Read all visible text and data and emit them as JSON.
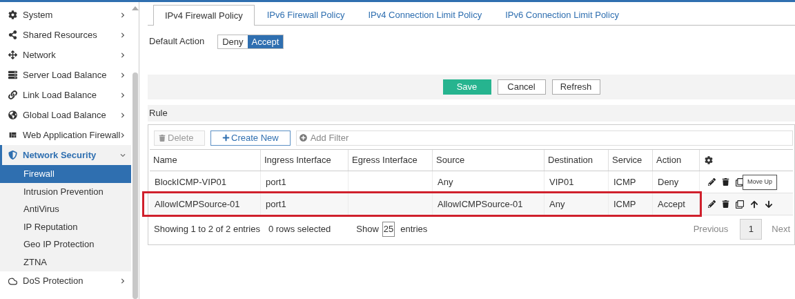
{
  "sidebar": {
    "items": [
      {
        "label": "System",
        "expanded": false
      },
      {
        "label": "Shared Resources",
        "expanded": false
      },
      {
        "label": "Network",
        "expanded": false
      },
      {
        "label": "Server Load Balance",
        "expanded": false
      },
      {
        "label": "Link Load Balance",
        "expanded": false
      },
      {
        "label": "Global Load Balance",
        "expanded": false
      },
      {
        "label": "Web Application Firewall",
        "expanded": false
      },
      {
        "label": "Network Security",
        "expanded": true,
        "children": [
          {
            "label": "Firewall",
            "selected": true
          },
          {
            "label": "Intrusion Prevention",
            "selected": false
          },
          {
            "label": "AntiVirus",
            "selected": false
          },
          {
            "label": "IP Reputation",
            "selected": false
          },
          {
            "label": "Geo IP Protection",
            "selected": false
          },
          {
            "label": "ZTNA",
            "selected": false
          }
        ]
      },
      {
        "label": "DoS Protection",
        "expanded": false
      }
    ]
  },
  "tabs": [
    {
      "label": "IPv4 Firewall Policy",
      "selected": true
    },
    {
      "label": "IPv6 Firewall Policy",
      "selected": false
    },
    {
      "label": "IPv4 Connection Limit Policy",
      "selected": false
    },
    {
      "label": "IPv6 Connection Limit Policy",
      "selected": false
    }
  ],
  "default_action": {
    "label": "Default Action",
    "options": [
      {
        "label": "Deny",
        "selected": false
      },
      {
        "label": "Accept",
        "selected": true
      }
    ]
  },
  "buttons": {
    "save": "Save",
    "cancel": "Cancel",
    "refresh": "Refresh"
  },
  "rule": {
    "title": "Rule",
    "toolbar": {
      "delete": "Delete",
      "create": "Create New",
      "filter_placeholder": "Add Filter"
    },
    "table": {
      "columns": [
        "Name",
        "Ingress Interface",
        "Egress Interface",
        "Source",
        "Destination",
        "Service",
        "Action"
      ],
      "rows": [
        {
          "cells": [
            "BlockICMP-VIP01",
            "port1",
            "",
            "Any",
            "VIP01",
            "ICMP",
            "Deny"
          ],
          "highlighted": false,
          "tooltip": "Move Up"
        },
        {
          "cells": [
            "AllowICMPSource-01",
            "port1",
            "",
            "AllowICMPSource-01",
            "Any",
            "ICMP",
            "Accept"
          ],
          "highlighted": true
        }
      ]
    },
    "footer": {
      "info": "Showing 1 to 2 of 2 entries",
      "selected": "0 rows selected",
      "show": "Show",
      "page_size": "25",
      "entries": "entries",
      "previous": "Previous",
      "page": "1",
      "next": "Next"
    }
  }
}
